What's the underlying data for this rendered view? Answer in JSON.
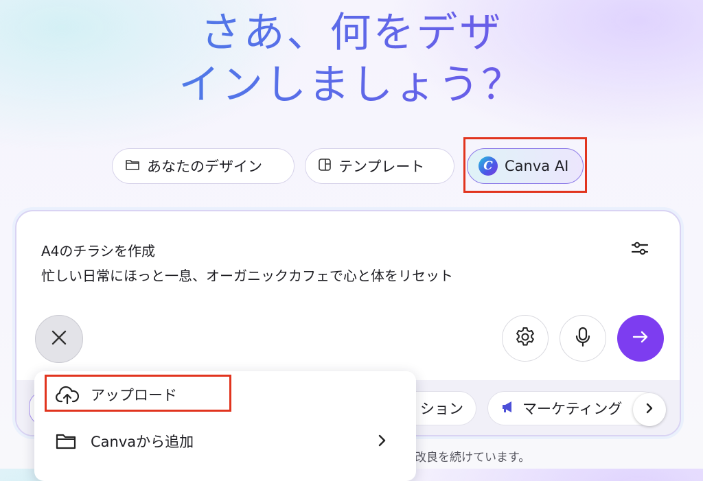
{
  "headline": {
    "line1": "さあ、何をデザ",
    "line2": "インしましょう？"
  },
  "tabs": {
    "designs": "あなたのデザイン",
    "templates": "テンプレート",
    "canva_ai": "Canva AI"
  },
  "prompt": {
    "line1": "A4のチラシを作成",
    "line2": "忙しい日常にほっと一息、オーガニックカフェで心と体をリセット"
  },
  "chips": {
    "partial_left": "ション",
    "marketing": "マーケティング"
  },
  "menu": {
    "upload": "アップロード",
    "add_from_canva": "Canvaから追加"
  },
  "footnote": "改良を続けています。",
  "colors": {
    "accent": "#7d3df0",
    "highlight": "#e1341e",
    "ai_border": "#8c7ae8"
  },
  "icons": [
    "folder-icon",
    "template-icon",
    "canva-ai-icon",
    "adjust-icon",
    "close-icon",
    "settings-icon",
    "mic-icon",
    "send-arrow-icon",
    "megaphone-icon",
    "chevron-right-icon",
    "cloud-upload-icon"
  ]
}
